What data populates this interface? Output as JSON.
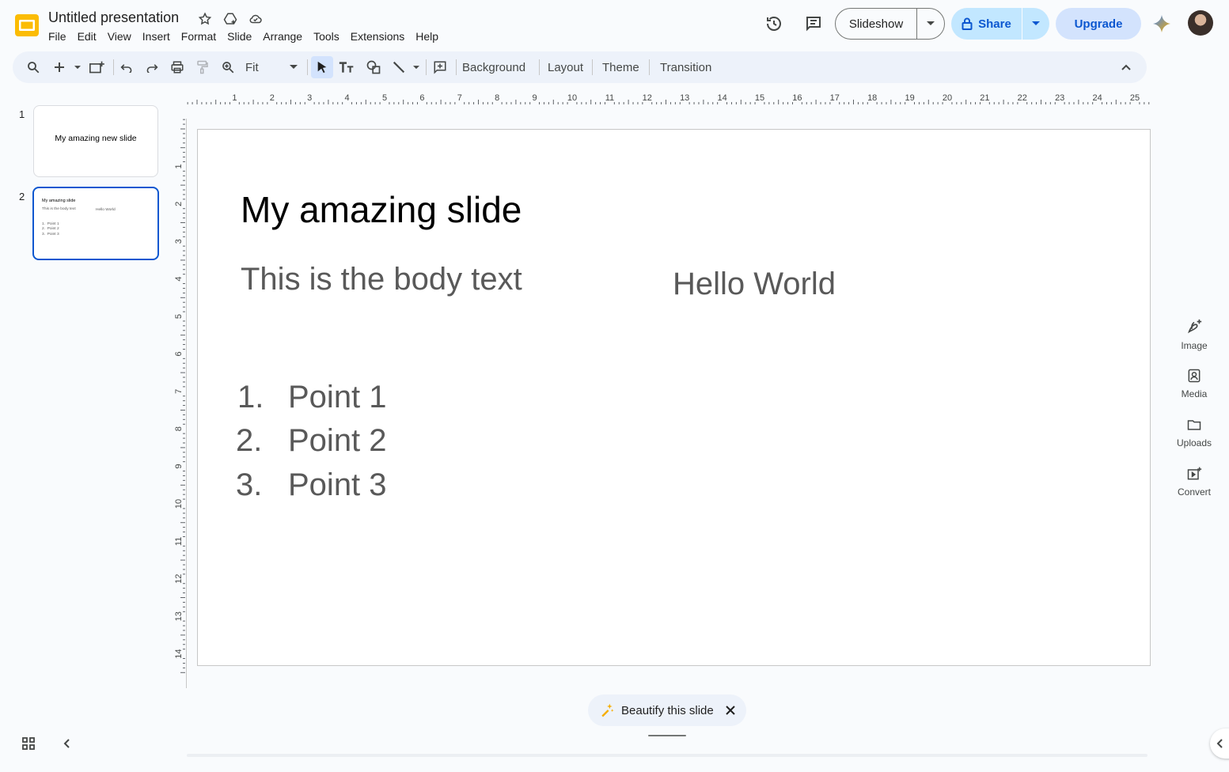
{
  "header": {
    "title": "Untitled presentation",
    "menu": [
      "File",
      "Edit",
      "View",
      "Insert",
      "Format",
      "Slide",
      "Arrange",
      "Tools",
      "Extensions",
      "Help"
    ],
    "slideshow_label": "Slideshow",
    "share_label": "Share",
    "upgrade_label": "Upgrade"
  },
  "toolbar": {
    "zoom_value": "Fit",
    "background_label": "Background",
    "layout_label": "Layout",
    "theme_label": "Theme",
    "transition_label": "Transition"
  },
  "filmstrip": {
    "slides": [
      {
        "number": "1",
        "title": "My amazing new slide"
      },
      {
        "number": "2",
        "title": "My amazing slide",
        "body": "This is the body text",
        "hello": "Hello World",
        "points": [
          "1.",
          "Point 1",
          "2.",
          "Point 2",
          "3.",
          "Point 3"
        ]
      }
    ]
  },
  "rulers": {
    "horizontal": [
      "1",
      "2",
      "3",
      "4",
      "5",
      "6",
      "7",
      "8",
      "9",
      "10",
      "11",
      "12",
      "13",
      "14",
      "15",
      "16",
      "17",
      "18",
      "19",
      "20",
      "21",
      "22",
      "23",
      "24",
      "25"
    ],
    "vertical": [
      "1",
      "2",
      "3",
      "4",
      "5",
      "6",
      "7",
      "8",
      "9",
      "10",
      "11",
      "12",
      "13",
      "14"
    ]
  },
  "slide": {
    "title": "My amazing slide",
    "body": "This is the body text",
    "hello": "Hello World",
    "list": [
      {
        "num": "1.",
        "text": "Point 1"
      },
      {
        "num": "2.",
        "text": "Point 2"
      },
      {
        "num": "3.",
        "text": "Point 3"
      }
    ]
  },
  "side_panel": {
    "image_label": "Image",
    "media_label": "Media",
    "uploads_label": "Uploads",
    "convert_label": "Convert"
  },
  "bottom": {
    "beautify_label": "Beautify this slide"
  },
  "colors": {
    "accent": "#0b57d0",
    "share_bg": "#c2e7ff",
    "upgrade_bg": "#d3e3fd",
    "logo": "#fbbc04"
  }
}
